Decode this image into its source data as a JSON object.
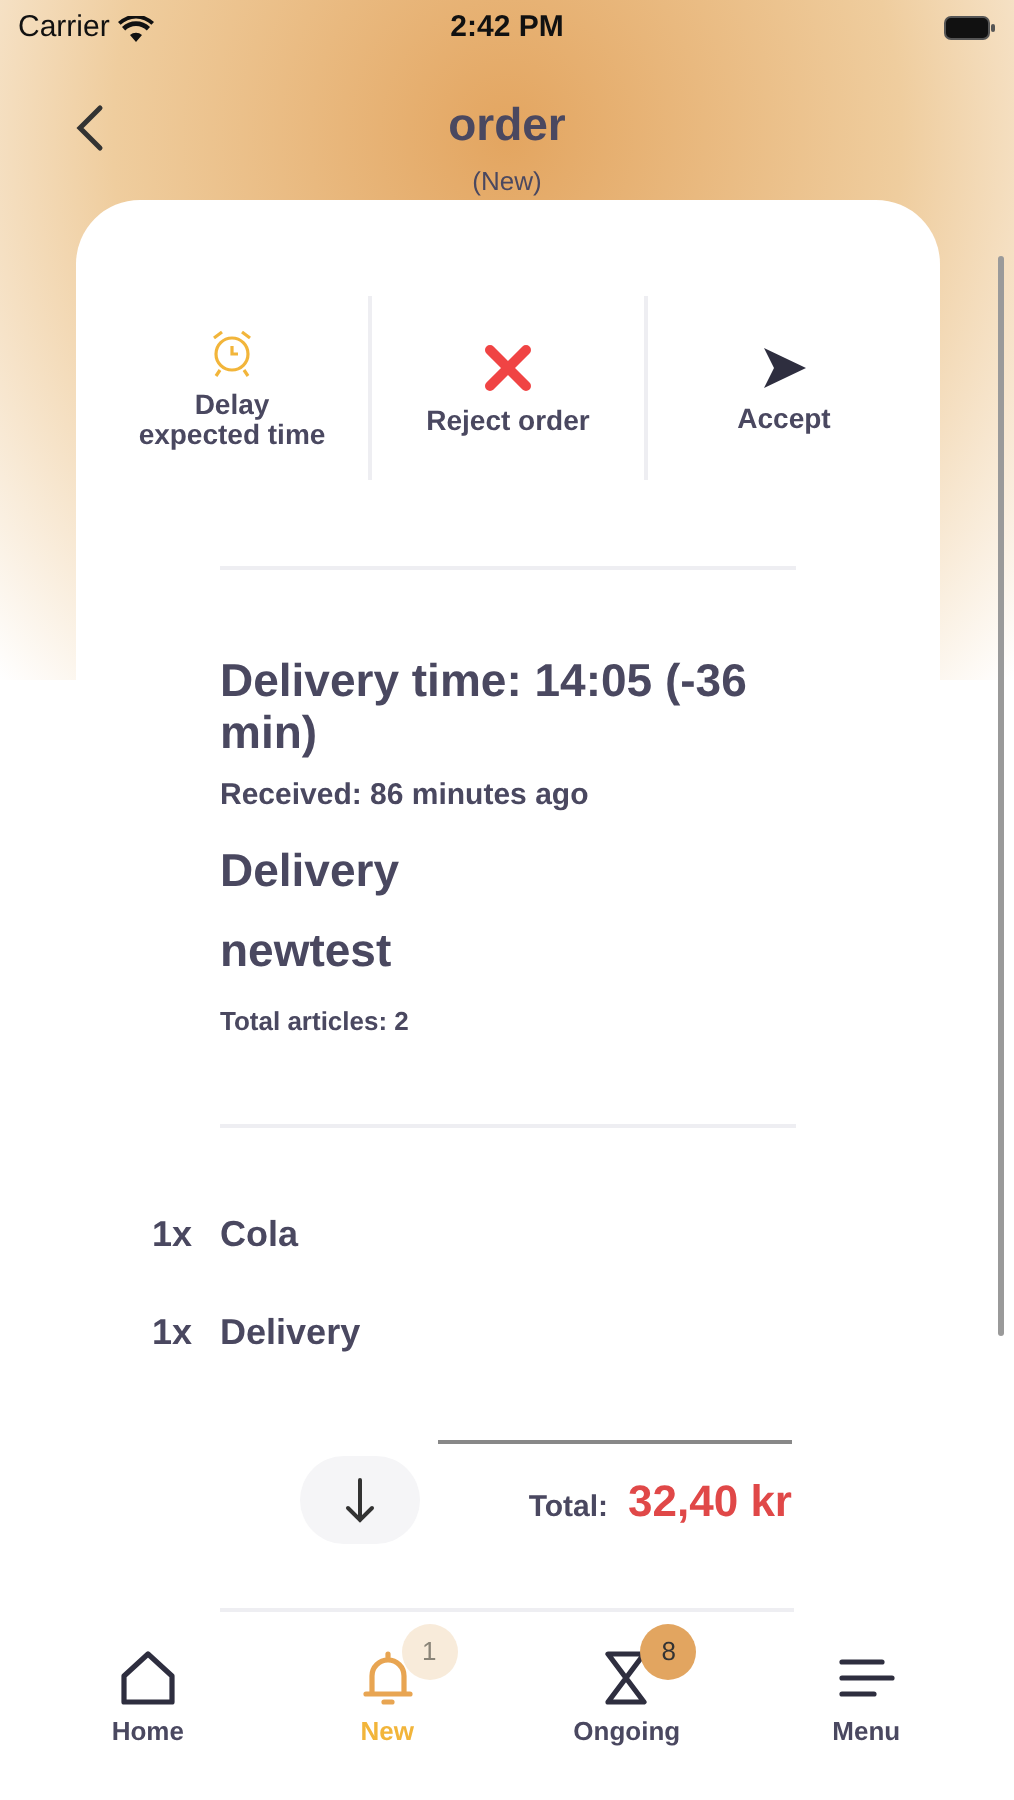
{
  "status_bar": {
    "carrier": "Carrier",
    "time": "2:42 PM"
  },
  "header": {
    "title": "order",
    "subtitle": "(New)"
  },
  "actions": [
    {
      "kind": "delay",
      "label": "Delay expected time"
    },
    {
      "kind": "reject",
      "label": "Reject order"
    },
    {
      "kind": "accept",
      "label": "Accept"
    }
  ],
  "order": {
    "delivery_time": "Delivery time: 14:05 (-36 min)",
    "received": "Received: 86 minutes ago",
    "type": "Delivery",
    "customer": "newtest",
    "total_articles": "Total articles: 2"
  },
  "items": [
    {
      "qty": "1x",
      "name": "Cola"
    },
    {
      "qty": "1x",
      "name": "Delivery"
    }
  ],
  "total": {
    "label": "Total:",
    "amount": "32,40 kr"
  },
  "tabs": [
    {
      "kind": "home",
      "label": "Home",
      "selected": false
    },
    {
      "kind": "bell",
      "label": "New",
      "selected": true,
      "badge": "1"
    },
    {
      "kind": "hourglass",
      "label": "Ongoing",
      "selected": false,
      "badge": "8"
    },
    {
      "kind": "menu",
      "label": "Menu",
      "selected": false
    }
  ]
}
